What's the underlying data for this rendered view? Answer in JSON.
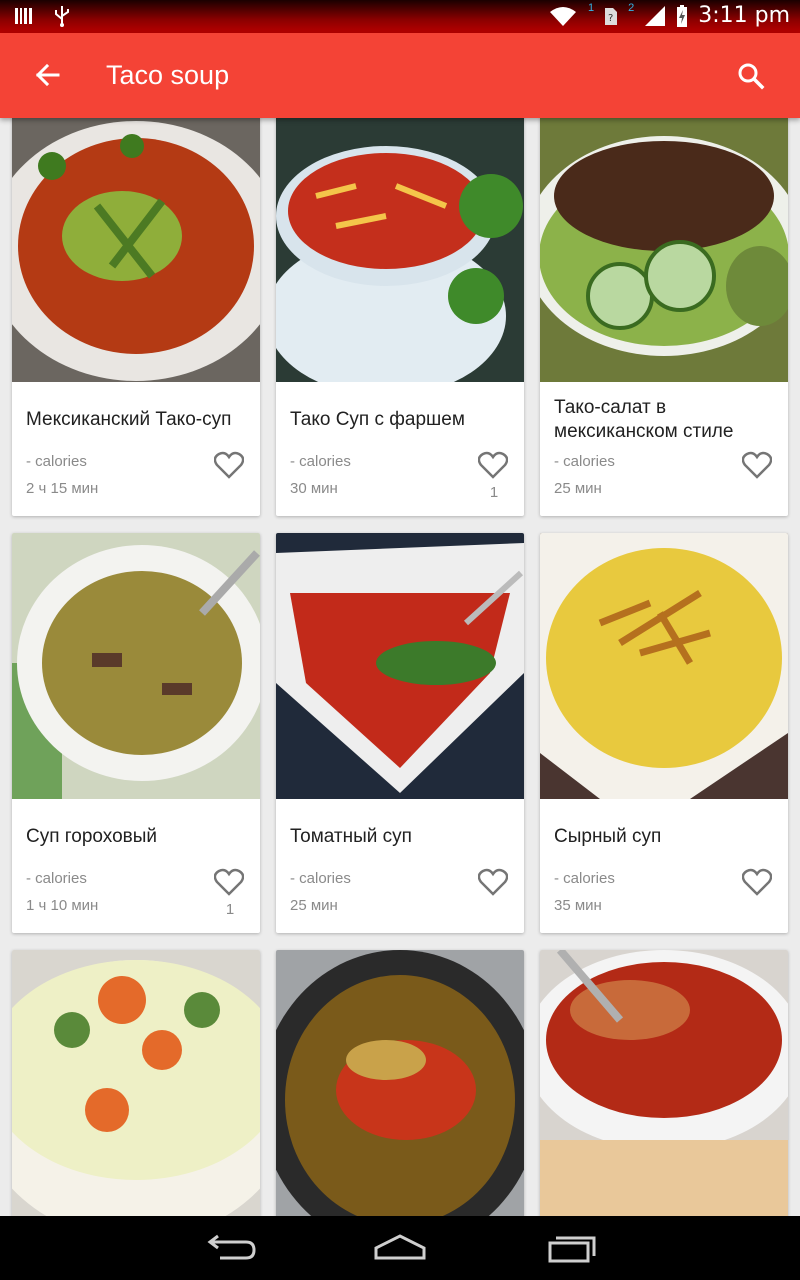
{
  "status_bar": {
    "time": "3:11 pm",
    "sim1": "1",
    "sim2": "2",
    "icons": [
      "barcode-icon",
      "usb-icon",
      "wifi-icon",
      "sim-icon",
      "signal-icon",
      "battery-charging-icon"
    ]
  },
  "app_bar": {
    "title": "Taco soup",
    "back_icon": "arrow-back-icon",
    "search_icon": "search-icon"
  },
  "recipes": [
    {
      "name": "Мексиканский Тако-суп",
      "calories": "- calories",
      "time": "2 ч 15 мин",
      "likes": ""
    },
    {
      "name": "Тако Суп с фаршем",
      "calories": "- calories",
      "time": "30 мин",
      "likes": "1"
    },
    {
      "name": "Тако-салат в мексиканском стиле",
      "calories": "- calories",
      "time": "25 мин",
      "likes": ""
    },
    {
      "name": "Суп гороховый",
      "calories": "- calories",
      "time": "1 ч 10 мин",
      "likes": "1"
    },
    {
      "name": "Томатный суп",
      "calories": "- calories",
      "time": "25 мин",
      "likes": ""
    },
    {
      "name": "Сырный суп",
      "calories": "- calories",
      "time": "35 мин",
      "likes": ""
    },
    {
      "name": "",
      "calories": "",
      "time": "",
      "likes": ""
    },
    {
      "name": "",
      "calories": "",
      "time": "",
      "likes": ""
    },
    {
      "name": "",
      "calories": "",
      "time": "",
      "likes": ""
    }
  ],
  "nav_bar": {
    "back": "nav-back-icon",
    "home": "nav-home-icon",
    "recents": "nav-recents-icon"
  },
  "colors": {
    "app_bar": "#f44336",
    "background": "#ececec"
  }
}
